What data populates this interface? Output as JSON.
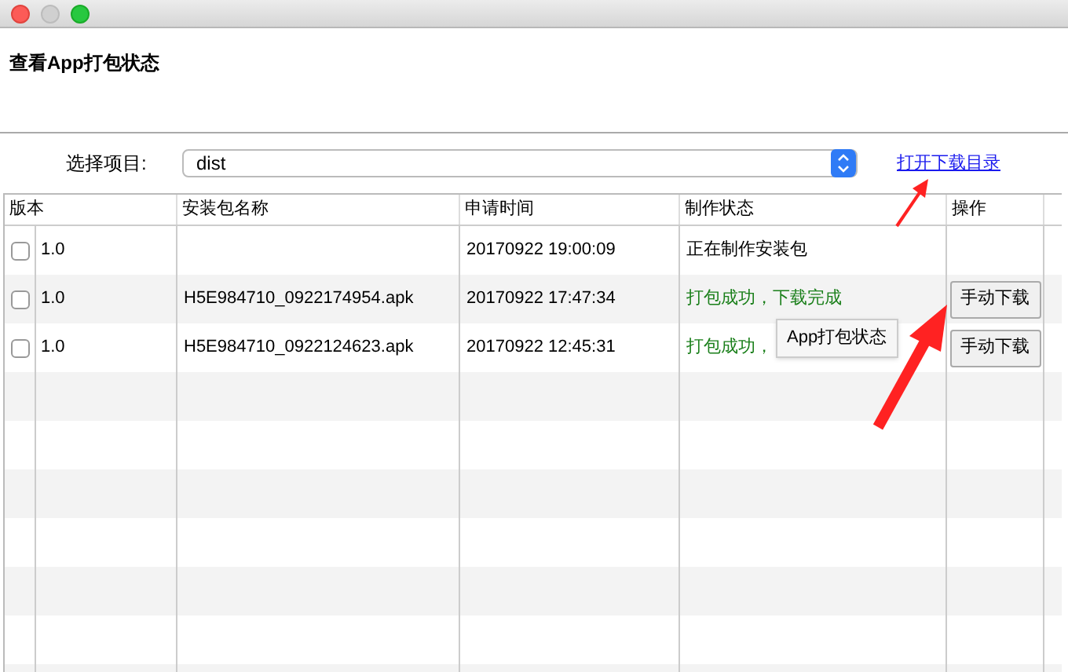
{
  "window": {
    "title": "查看App打包状态"
  },
  "project": {
    "label": "选择项目:",
    "value": "dist"
  },
  "open_folder_link": "打开下载目录",
  "table": {
    "columns": [
      "版本",
      "安装包名称",
      "申请时间",
      "制作状态",
      "操作"
    ],
    "rows": [
      {
        "checked": false,
        "version": "1.0",
        "package": "",
        "time": "20170922 19:00:09",
        "status": "正在制作安装包",
        "kind": "progress"
      },
      {
        "checked": false,
        "version": "1.0",
        "package": "H5E984710_0922174954.apk",
        "time": "20170922 17:47:34",
        "status": "打包成功，下载完成",
        "kind": "success",
        "action": "手动下载"
      },
      {
        "checked": false,
        "version": "1.0",
        "package": "H5E984710_0922124623.apk",
        "time": "20170922 12:45:31",
        "status": "打包成功，",
        "kind": "success",
        "action": "手动下载"
      }
    ]
  },
  "tooltip": "App打包状态"
}
